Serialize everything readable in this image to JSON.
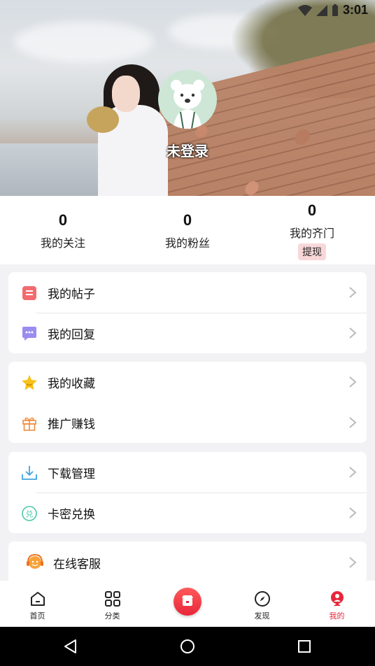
{
  "status_bar": {
    "time": "3:01"
  },
  "profile": {
    "login_status": "未登录"
  },
  "stats": [
    {
      "value": "0",
      "label": "我的关注"
    },
    {
      "value": "0",
      "label": "我的粉丝"
    },
    {
      "value": "0",
      "label": "我的齐门",
      "action": "提现"
    }
  ],
  "menu_groups": [
    {
      "items": [
        {
          "label": "我的帖子",
          "icon": "post-icon"
        },
        {
          "label": "我的回复",
          "icon": "reply-icon"
        }
      ]
    },
    {
      "items": [
        {
          "label": "我的收藏",
          "icon": "star-icon"
        },
        {
          "label": "推广赚钱",
          "icon": "gift-icon"
        }
      ]
    },
    {
      "items": [
        {
          "label": "下载管理",
          "icon": "download-icon"
        },
        {
          "label": "卡密兑换",
          "icon": "redeem-icon"
        }
      ]
    },
    {
      "items": [
        {
          "label": "在线客服",
          "icon": "support-icon"
        }
      ]
    }
  ],
  "bottom_nav": [
    {
      "label": "首页",
      "icon": "home-icon"
    },
    {
      "label": "分类",
      "icon": "grid-icon"
    },
    {
      "label": "",
      "icon": "store-icon"
    },
    {
      "label": "发现",
      "icon": "compass-icon"
    },
    {
      "label": "我的",
      "icon": "profile-icon",
      "active": true
    }
  ],
  "colors": {
    "accent": "#e8263a",
    "active_nav": "#e8263a",
    "withdraw_bg": "#f8d7d8"
  }
}
